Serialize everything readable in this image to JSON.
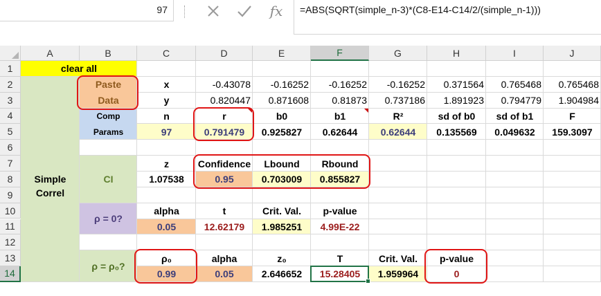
{
  "namebox": {
    "value": "97"
  },
  "formula_bar": {
    "cancel_icon": "x-icon",
    "enter_icon": "check-icon",
    "fx_label": "fx",
    "formula": "=ABS(SQRT(simple_n-3)*(C8-E14-C14/2/(simple_n-1)))"
  },
  "columns": [
    "A",
    "B",
    "C",
    "D",
    "E",
    "F",
    "G",
    "H",
    "I",
    "J"
  ],
  "rows": [
    "1",
    "2",
    "3",
    "4",
    "5",
    "6",
    "7",
    "8",
    "9",
    "10",
    "11",
    "12",
    "13",
    "14"
  ],
  "selected": {
    "column": "F",
    "row": "14"
  },
  "colors": {
    "yellow": "#ffff00",
    "green": "#d9e7c2",
    "orange": "#f9c79a",
    "cream": "#fefdc9",
    "blue": "#c6d8f0",
    "purple": "#cfc3e2",
    "pasteDark": "#8f5b1e",
    "dataRed": "#9b1c1c",
    "ring": "#e01515",
    "excelGreen": "#217346"
  },
  "cells": {
    "A1": "clear all",
    "B2": "Paste",
    "B3": "Data",
    "C2": "x",
    "D2": "-0.43078",
    "E2": "-0.16252",
    "F2": "-0.16252",
    "G2": "-0.16252",
    "H2": "0.371564",
    "I2": "0.765468",
    "J2": "0.765468",
    "C3": "y",
    "D3": "0.820447",
    "E3": "0.871608",
    "F3": "0.81873",
    "G3": "0.737186",
    "H3": "1.891923",
    "I3": "0.794779",
    "J3": "1.904984",
    "B4": "Comp",
    "B5": "Params",
    "C4": "n",
    "D4": "r",
    "E4": "b0",
    "F4": "b1",
    "G4": "R²",
    "H4": "sd of b0",
    "I4": "sd of b1",
    "J4": "F",
    "C5": "97",
    "D5": "0.791479",
    "E5": "0.925827",
    "F5": "0.62644",
    "G5": "0.62644",
    "H5": "0.135569",
    "I5": "0.049632",
    "J5": "159.3097",
    "A8a": "Simple",
    "A8b": "Correl",
    "B8": "CI",
    "C7": "z",
    "D7": "Confidence",
    "E7": "Lbound",
    "F7": "Rbound",
    "C8": "1.07538",
    "D8": "0.95",
    "E8": "0.703009",
    "F8": "0.855827",
    "B11": "ρ = 0?",
    "C10": "alpha",
    "D10": "t",
    "E10": "Crit. Val.",
    "F10": "p-value",
    "C11": "0.05",
    "D11": "12.62179",
    "E11": "1.985251",
    "F11": "4.99E-22",
    "B14": "ρ = ρ₀?",
    "C13": "ρ₀",
    "D13": "alpha",
    "E13": "z₀",
    "F13": "T",
    "G13": "Crit. Val.",
    "H13": "p-value",
    "C14": "0.99",
    "D14": "0.05",
    "E14": "2.646652",
    "F14": "15.28405",
    "G14": "1.959964",
    "H14": "0"
  }
}
